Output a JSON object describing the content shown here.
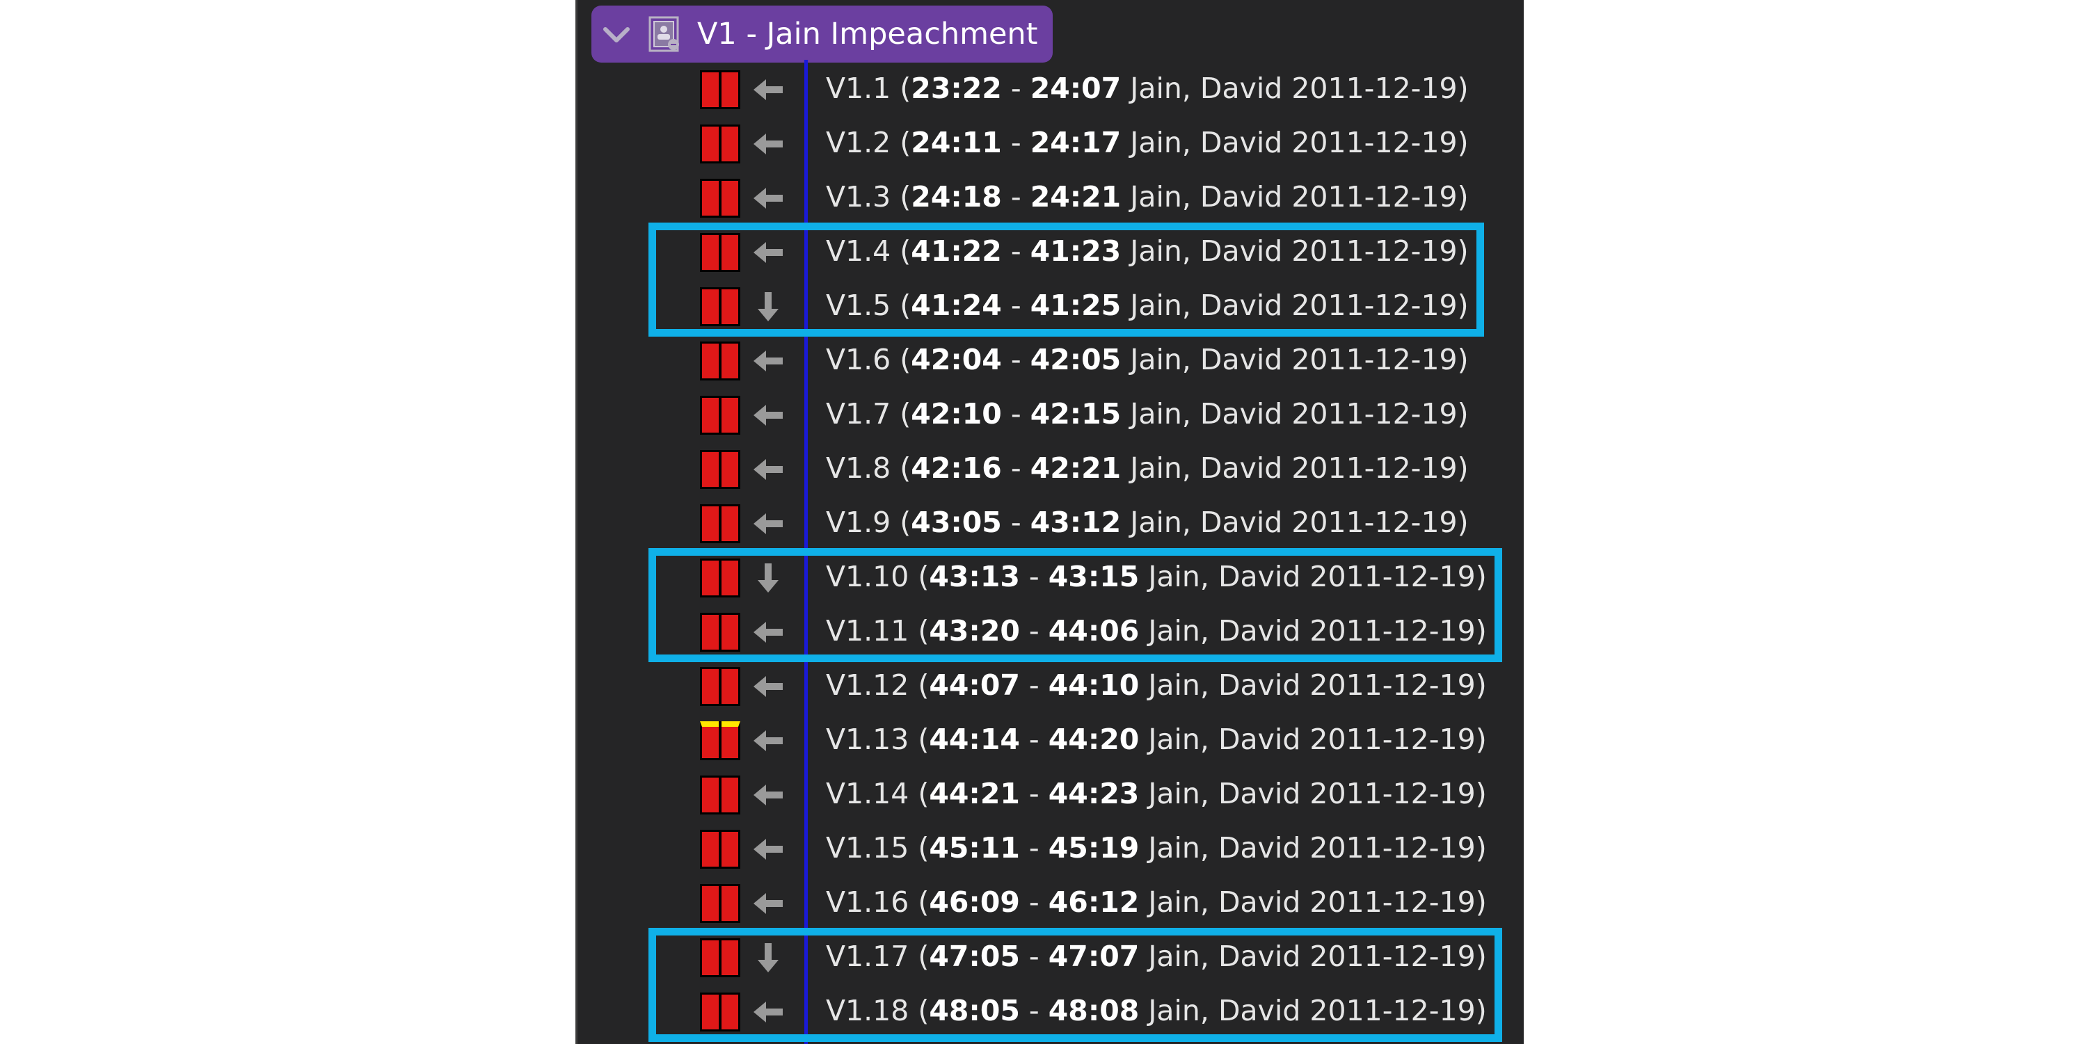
{
  "header": {
    "title": "V1 - Jain Impeachment",
    "icon": "transcript-document-icon",
    "expand_icon": "chevron-down-icon"
  },
  "colors": {
    "header_bg": "#6b3fa0",
    "panel_bg": "#252526",
    "segment_red": "#e01818",
    "segment_yellow_marker": "#ffe600",
    "highlight_box": "#0fb0e8",
    "tree_line": "#1a1ad6"
  },
  "rows": [
    {
      "id": "V1.1",
      "start": "23:22",
      "end": "24:07",
      "speaker": "Jain, David",
      "date": "2011-12-19",
      "direction": "left-arrow-icon",
      "marker": "red"
    },
    {
      "id": "V1.2",
      "start": "24:11",
      "end": "24:17",
      "speaker": "Jain, David",
      "date": "2011-12-19",
      "direction": "left-arrow-icon",
      "marker": "red"
    },
    {
      "id": "V1.3",
      "start": "24:18",
      "end": "24:21",
      "speaker": "Jain, David",
      "date": "2011-12-19",
      "direction": "left-arrow-icon",
      "marker": "red"
    },
    {
      "id": "V1.4",
      "start": "41:22",
      "end": "41:23",
      "speaker": "Jain, David",
      "date": "2011-12-19",
      "direction": "left-arrow-icon",
      "marker": "red"
    },
    {
      "id": "V1.5",
      "start": "41:24",
      "end": "41:25",
      "speaker": "Jain, David",
      "date": "2011-12-19",
      "direction": "down-arrow-icon",
      "marker": "red"
    },
    {
      "id": "V1.6",
      "start": "42:04",
      "end": "42:05",
      "speaker": "Jain, David",
      "date": "2011-12-19",
      "direction": "left-arrow-icon",
      "marker": "red"
    },
    {
      "id": "V1.7",
      "start": "42:10",
      "end": "42:15",
      "speaker": "Jain, David",
      "date": "2011-12-19",
      "direction": "left-arrow-icon",
      "marker": "red"
    },
    {
      "id": "V1.8",
      "start": "42:16",
      "end": "42:21",
      "speaker": "Jain, David",
      "date": "2011-12-19",
      "direction": "left-arrow-icon",
      "marker": "red"
    },
    {
      "id": "V1.9",
      "start": "43:05",
      "end": "43:12",
      "speaker": "Jain, David",
      "date": "2011-12-19",
      "direction": "left-arrow-icon",
      "marker": "red"
    },
    {
      "id": "V1.10",
      "start": "43:13",
      "end": "43:15",
      "speaker": "Jain, David",
      "date": "2011-12-19",
      "direction": "down-arrow-icon",
      "marker": "red"
    },
    {
      "id": "V1.11",
      "start": "43:20",
      "end": "44:06",
      "speaker": "Jain, David",
      "date": "2011-12-19",
      "direction": "left-arrow-icon",
      "marker": "red"
    },
    {
      "id": "V1.12",
      "start": "44:07",
      "end": "44:10",
      "speaker": "Jain, David",
      "date": "2011-12-19",
      "direction": "left-arrow-icon",
      "marker": "red"
    },
    {
      "id": "V1.13",
      "start": "44:14",
      "end": "44:20",
      "speaker": "Jain, David",
      "date": "2011-12-19",
      "direction": "left-arrow-icon",
      "marker": "yellow"
    },
    {
      "id": "V1.14",
      "start": "44:21",
      "end": "44:23",
      "speaker": "Jain, David",
      "date": "2011-12-19",
      "direction": "left-arrow-icon",
      "marker": "red"
    },
    {
      "id": "V1.15",
      "start": "45:11",
      "end": "45:19",
      "speaker": "Jain, David",
      "date": "2011-12-19",
      "direction": "left-arrow-icon",
      "marker": "red"
    },
    {
      "id": "V1.16",
      "start": "46:09",
      "end": "46:12",
      "speaker": "Jain, David",
      "date": "2011-12-19",
      "direction": "left-arrow-icon",
      "marker": "red"
    },
    {
      "id": "V1.17",
      "start": "47:05",
      "end": "47:07",
      "speaker": "Jain, David",
      "date": "2011-12-19",
      "direction": "down-arrow-icon",
      "marker": "red"
    },
    {
      "id": "V1.18",
      "start": "48:05",
      "end": "48:08",
      "speaker": "Jain, David",
      "date": "2011-12-19",
      "direction": "left-arrow-icon",
      "marker": "red"
    }
  ],
  "highlight_groups": [
    {
      "rows": [
        "V1.4",
        "V1.5"
      ]
    },
    {
      "rows": [
        "V1.10",
        "V1.11"
      ]
    },
    {
      "rows": [
        "V1.17",
        "V1.18"
      ]
    }
  ]
}
